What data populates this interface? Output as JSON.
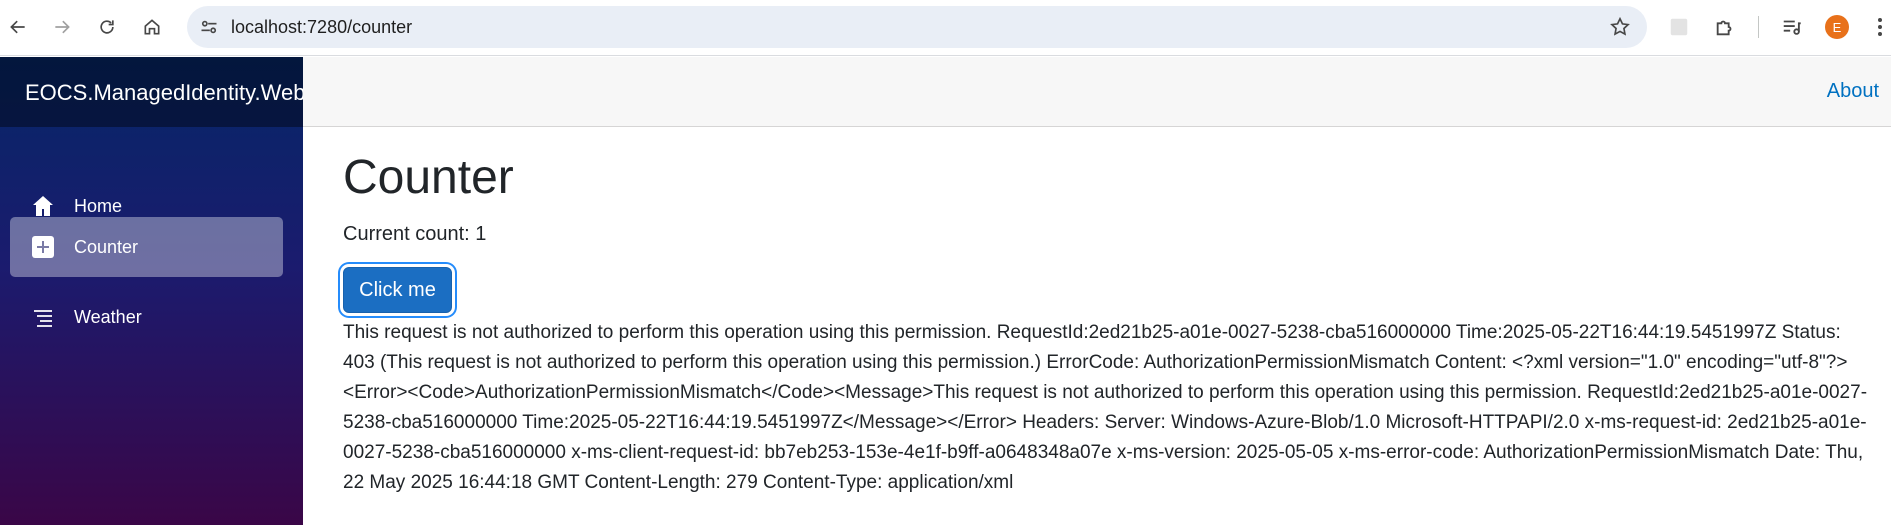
{
  "browser": {
    "url": "localhost:7280/counter",
    "profile_initial": "E",
    "icons": [
      "back-icon",
      "forward-icon",
      "reload-icon",
      "home-icon",
      "site-info-icon",
      "star-icon",
      "extension-icon",
      "puzzle-icon",
      "media-icon",
      "menu-icon"
    ]
  },
  "app": {
    "brand": "EOCS.ManagedIdentity.Web",
    "about_label": "About",
    "nav": [
      {
        "label": "Home",
        "icon": "house-icon",
        "active": false
      },
      {
        "label": "Counter",
        "icon": "plus-square-icon",
        "active": true
      },
      {
        "label": "Weather",
        "icon": "list-icon",
        "active": false
      }
    ]
  },
  "main": {
    "title": "Counter",
    "count_text": "Current count: 1",
    "button_label": "Click me",
    "error_message": "This request is not authorized to perform this operation using this permission. RequestId:2ed21b25-a01e-0027-5238-cba516000000 Time:2025-05-22T16:44:19.5451997Z Status: 403 (This request is not authorized to perform this operation using this permission.) ErrorCode: AuthorizationPermissionMismatch Content: <?xml version=\"1.0\" encoding=\"utf-8\"?><Error><Code>AuthorizationPermissionMismatch</Code><Message>This request is not authorized to perform this operation using this permission. RequestId:2ed21b25-a01e-0027-5238-cba516000000 Time:2025-05-22T16:44:19.5451997Z</Message></Error> Headers: Server: Windows-Azure-Blob/1.0 Microsoft-HTTPAPI/2.0 x-ms-request-id: 2ed21b25-a01e-0027-5238-cba516000000 x-ms-client-request-id: bb7eb253-153e-4e1f-b9ff-a0648348a07e x-ms-version: 2025-05-05 x-ms-error-code: AuthorizationPermissionMismatch Date: Thu, 22 May 2025 16:44:18 GMT Content-Length: 279 Content-Type: application/xml"
  },
  "colors": {
    "sidebar_top": "#052767",
    "sidebar_bottom": "#3a0647",
    "button": "#1b6ec2",
    "link": "#0071c1",
    "profile": "#e8711a"
  }
}
